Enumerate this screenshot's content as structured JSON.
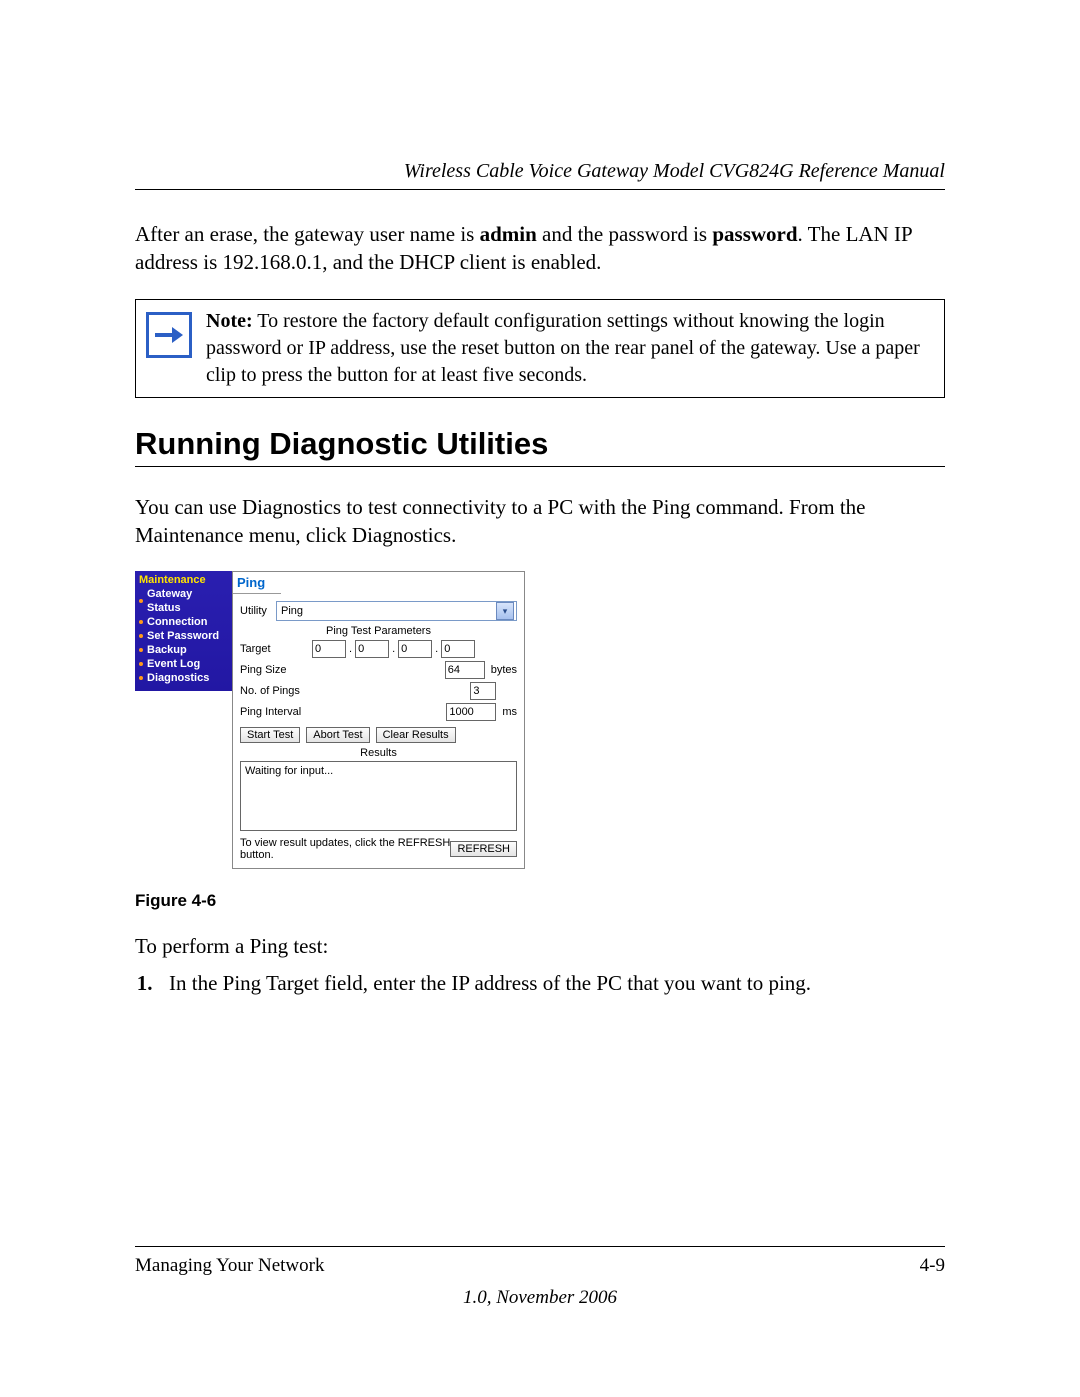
{
  "header": "Wireless Cable Voice Gateway Model CVG824G Reference Manual",
  "para1_pre": "After an erase, the gateway user name is ",
  "para1_b1": "admin",
  "para1_mid": " and the password is ",
  "para1_b2": "password",
  "para1_end": ". The LAN IP address is 192.168.0.1, and the DHCP client is enabled.",
  "note_label": "Note:",
  "note_body": " To restore the factory default configuration settings without knowing the login password or IP address, use the reset button on the rear panel of the gateway. Use a paper clip to press the button for at least five seconds.",
  "section_heading": "Running Diagnostic Utilities",
  "para2": "You can use Diagnostics to test connectivity to a PC with the Ping command. From the Maintenance menu, click Diagnostics.",
  "sidebar": {
    "title": "Maintenance",
    "items": [
      "Gateway Status",
      "Connection",
      "Set Password",
      "Backup",
      "Event Log",
      "Diagnostics"
    ]
  },
  "panel": {
    "title": "Ping",
    "utility_label": "Utility",
    "utility_value": "Ping",
    "params_title": "Ping Test Parameters",
    "target_label": "Target",
    "target_ip": [
      "0",
      "0",
      "0",
      "0"
    ],
    "size_label": "Ping Size",
    "size_value": "64",
    "size_unit": "bytes",
    "count_label": "No. of Pings",
    "count_value": "3",
    "interval_label": "Ping Interval",
    "interval_value": "1000",
    "interval_unit": "ms",
    "btn_start": "Start Test",
    "btn_abort": "Abort Test",
    "btn_clear": "Clear Results",
    "results_title": "Results",
    "results_text": "Waiting for input...",
    "refresh_hint": "To view result updates, click the REFRESH button.",
    "btn_refresh": "REFRESH"
  },
  "figure_caption": "Figure 4-6",
  "para3": "To perform a Ping test:",
  "step1": "In the Ping Target field, enter the IP address of the PC that you want to ping.",
  "footer_left": "Managing Your Network",
  "footer_right": "4-9",
  "footer_version": "1.0, November 2006"
}
